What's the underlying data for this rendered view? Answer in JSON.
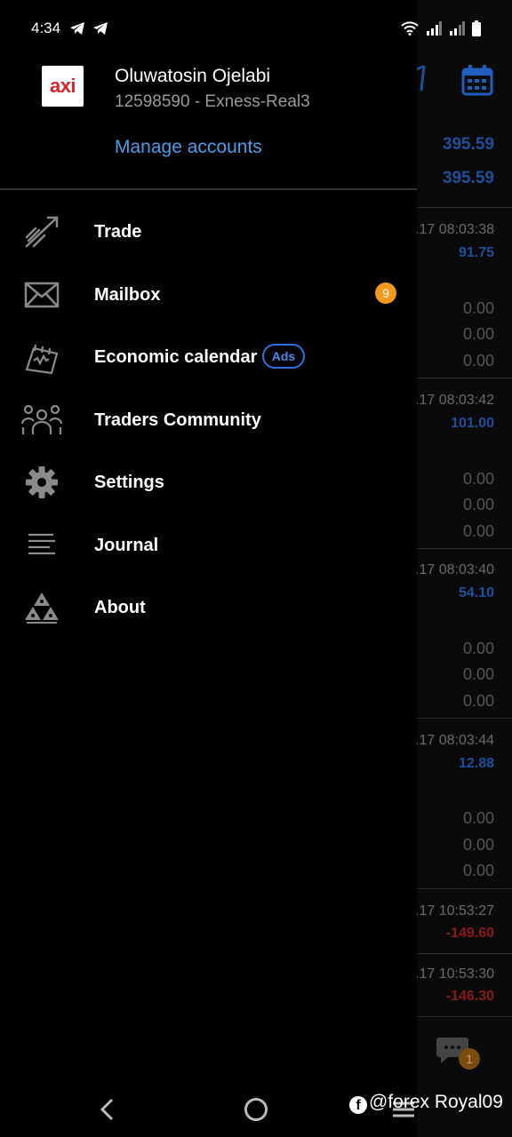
{
  "status_bar": {
    "time": "4:34"
  },
  "account": {
    "logo_text": "axi",
    "name": "Oluwatosin Ojelabi",
    "id_server": "12598590 - Exness-Real3",
    "manage_label": "Manage accounts"
  },
  "menu": {
    "items": [
      {
        "label": "Trade",
        "icon": "trade-icon"
      },
      {
        "label": "Mailbox",
        "icon": "mail-icon",
        "badge": "9"
      },
      {
        "label": "Economic calendar",
        "icon": "economic-calendar-icon",
        "tag": "Ads"
      },
      {
        "label": "Traders Community",
        "icon": "community-icon"
      },
      {
        "label": "Settings",
        "icon": "gear-icon"
      },
      {
        "label": "Journal",
        "icon": "journal-icon"
      },
      {
        "label": "About",
        "icon": "about-icon"
      }
    ]
  },
  "background": {
    "prices": [
      "395.59",
      "395.59"
    ],
    "deals": [
      {
        "time": ".17 08:03:38",
        "profit": "91.75"
      },
      {
        "time": ".17 08:03:42",
        "profit": "101.00"
      },
      {
        "time": ".17 08:03:40",
        "profit": "54.10"
      },
      {
        "time": ".17 08:03:44",
        "profit": "12.88"
      },
      {
        "time": ".17 10:53:27",
        "profit": "-149.60"
      },
      {
        "time": ".17 10:53:30",
        "profit": "-146.30"
      }
    ],
    "zero_value": "0.00",
    "chat_badge": "1"
  },
  "watermark": "@forex Royal09",
  "colors": {
    "accent_blue": "#4a9ee8",
    "badge_orange": "#f39a1e",
    "ads_blue": "#2f6fe0",
    "profit_blue": "#1f4f9a",
    "loss_red": "#8a1a1a"
  }
}
